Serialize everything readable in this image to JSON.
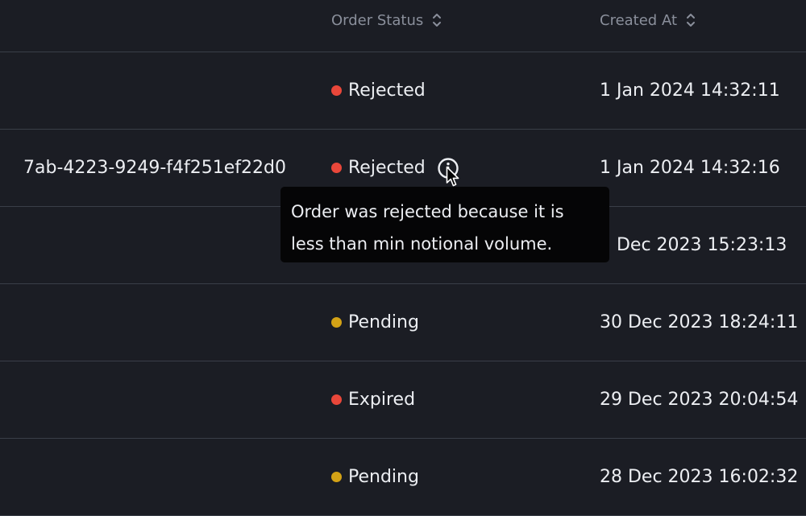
{
  "header": {
    "order_status": "Order Status",
    "created_at": "Created At"
  },
  "colors": {
    "rejected": "#e9473a",
    "expired": "#e9473a",
    "pending": "#d3a216",
    "background": "#1b1d24",
    "divider": "#3a3e48",
    "header_text": "#8a8f9b",
    "tooltip_bg": "#050506"
  },
  "rows": [
    {
      "order_id": "",
      "status": "Rejected",
      "status_color": "#e9473a",
      "created_at": "1 Jan 2024 14:32:11"
    },
    {
      "order_id": "7ab-4223-9249-f4f251ef22d0",
      "status": "Rejected",
      "status_color": "#e9473a",
      "created_at": "1 Jan 2024 14:32:16",
      "has_info": true
    },
    {
      "order_id": "",
      "status": "",
      "status_color": "#e9473a",
      "created_at": "1 Dec 2023 15:23:13"
    },
    {
      "order_id": "",
      "status": "Pending",
      "status_color": "#d3a216",
      "created_at": "30 Dec 2023 18:24:11"
    },
    {
      "order_id": "",
      "status": "Expired",
      "status_color": "#e9473a",
      "created_at": "29 Dec 2023 20:04:54"
    },
    {
      "order_id": "",
      "status": "Pending",
      "status_color": "#d3a216",
      "created_at": "28 Dec 2023 16:02:32"
    }
  ],
  "tooltip": {
    "line1": "Order was rejected because it is",
    "line2": "less than min notional volume."
  },
  "icons": {
    "sort": "sort-icon",
    "info": "info-icon",
    "cursor": "cursor-pointer-icon"
  }
}
